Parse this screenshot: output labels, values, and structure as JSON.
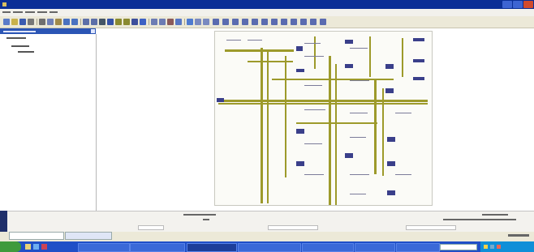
{
  "colors": {
    "titlebar": "#0b2f96",
    "menubar": "#f2f1ec",
    "toolbar": "#ece9d8",
    "panel_header": "#2b55b5",
    "wire": "#9d9a2b",
    "component": "#3a3f8a",
    "taskbar": "#1f4fc7",
    "start_button": "#3f9a3c",
    "tray": "#0f8fd8"
  },
  "titlebar": {
    "title": ""
  },
  "menubar": {
    "items": [
      "",
      "",
      "",
      "",
      "",
      ""
    ]
  },
  "toolbar": {
    "icons": [
      "new-icon",
      "open-icon",
      "save-icon",
      "print-icon",
      "cut-icon",
      "copy-icon",
      "paste-icon",
      "undo-icon",
      "redo-icon",
      "zoom-in-icon",
      "zoom-out-icon",
      "fit-icon",
      "select-icon",
      "wire-icon",
      "bus-icon",
      "component-icon",
      "label-icon",
      "rotate-icon",
      "mirror-icon",
      "delete-icon",
      "properties-icon",
      "help-icon"
    ]
  },
  "left_panel": {
    "title": "",
    "tree": [
      "",
      "",
      ""
    ]
  },
  "properties": {
    "fields": [
      "",
      "",
      "",
      "",
      "",
      ""
    ]
  },
  "tabs": [
    "",
    ""
  ],
  "taskbar": {
    "start": "",
    "tasks": [
      "",
      "",
      "",
      "",
      "",
      "",
      ""
    ],
    "clock": ""
  }
}
